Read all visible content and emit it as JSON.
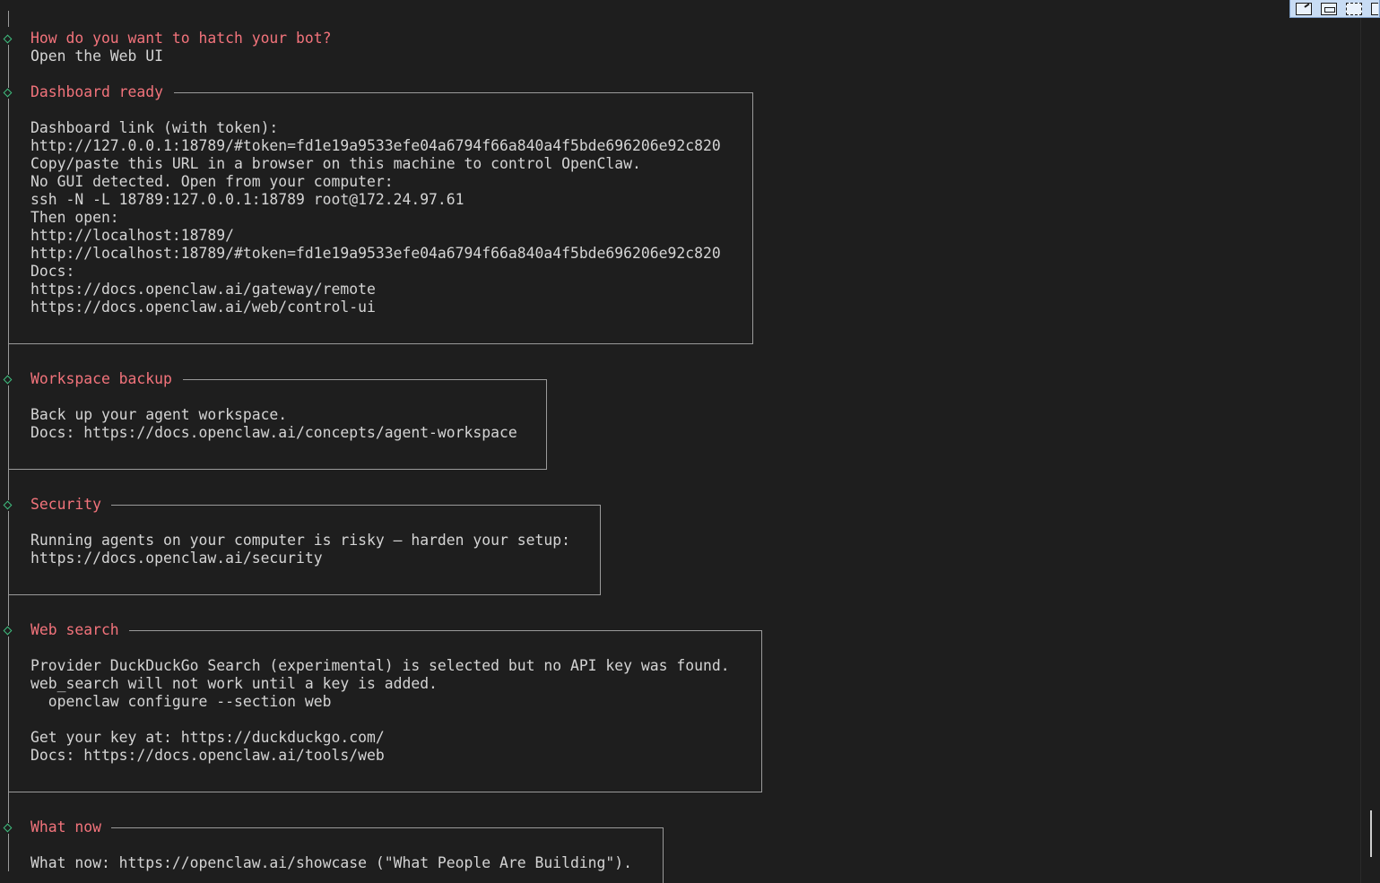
{
  "sections": {
    "hatch": {
      "title": "How do you want to hatch your bot?",
      "answer": "Open the Web UI"
    },
    "dashboard": {
      "title": "Dashboard ready",
      "lines": [
        "Dashboard link (with token):",
        "http://127.0.0.1:18789/#token=fd1e19a9533efe04a6794f66a840a4f5bde696206e92c820",
        "Copy/paste this URL in a browser on this machine to control OpenClaw.",
        "No GUI detected. Open from your computer:",
        "ssh -N -L 18789:127.0.0.1:18789 root@172.24.97.61",
        "Then open:",
        "http://localhost:18789/",
        "http://localhost:18789/#token=fd1e19a9533efe04a6794f66a840a4f5bde696206e92c820",
        "Docs:",
        "https://docs.openclaw.ai/gateway/remote",
        "https://docs.openclaw.ai/web/control-ui"
      ]
    },
    "backup": {
      "title": "Workspace backup",
      "lines": [
        "Back up your agent workspace.",
        "Docs: https://docs.openclaw.ai/concepts/agent-workspace"
      ]
    },
    "security": {
      "title": "Security",
      "lines": [
        "Running agents on your computer is risky — harden your setup:",
        "https://docs.openclaw.ai/security"
      ]
    },
    "websearch": {
      "title": "Web search",
      "lines": [
        "Provider DuckDuckGo Search (experimental) is selected but no API key was found.",
        "web_search will not work until a key is added.",
        "  openclaw configure --section web",
        "",
        "Get your key at: https://duckduckgo.com/",
        "Docs: https://docs.openclaw.ai/tools/web"
      ]
    },
    "whatnow": {
      "title": "What now",
      "lines": [
        "What now: https://openclaw.ai/showcase (\"What People Are Building\")."
      ]
    }
  },
  "toolbar": {
    "buttons": [
      "popout-icon",
      "restore-icon",
      "select-icon",
      "pin-icon"
    ]
  },
  "colors": {
    "background": "#1e1e1e",
    "text": "#d4d4d4",
    "title": "#f2737b",
    "diamond": "#3fbf7f",
    "border": "#9a9a9a"
  }
}
